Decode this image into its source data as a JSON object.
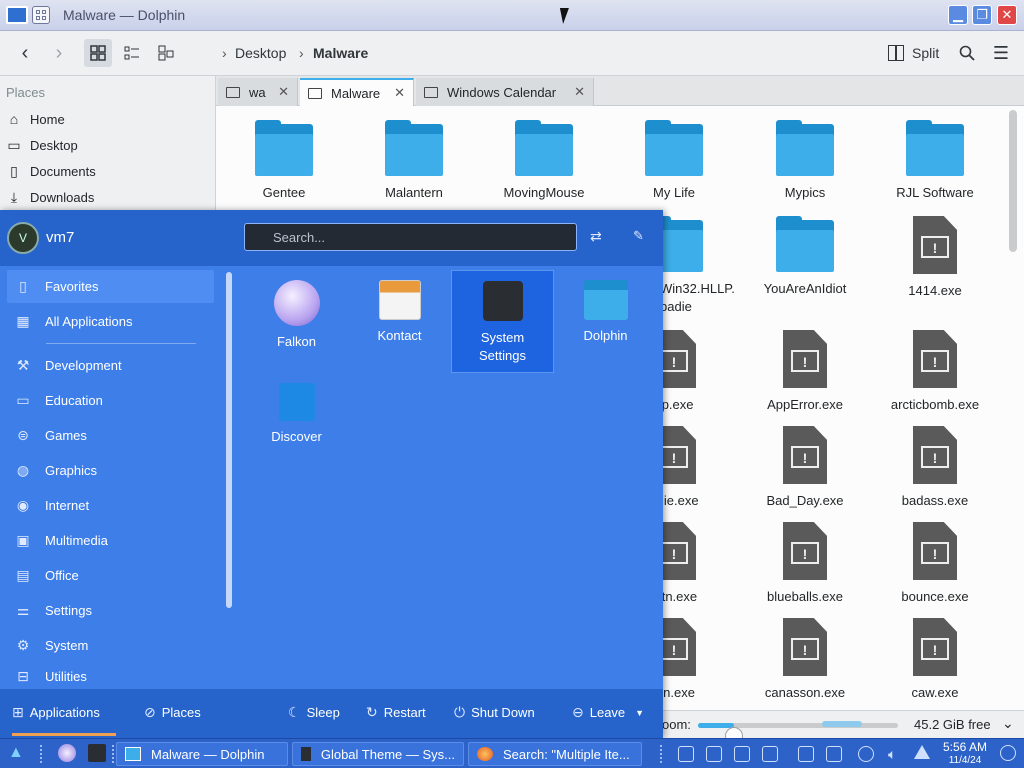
{
  "window": {
    "title": "Malware — Dolphin"
  },
  "toolbar": {
    "breadcrumbs": [
      "Desktop",
      "Malware"
    ],
    "split_label": "Split"
  },
  "places": {
    "header": "Places",
    "items": [
      {
        "label": "Home",
        "icon": "home-icon"
      },
      {
        "label": "Desktop",
        "icon": "desktop-icon"
      },
      {
        "label": "Documents",
        "icon": "documents-icon"
      },
      {
        "label": "Downloads",
        "icon": "downloads-icon"
      }
    ]
  },
  "tabs": [
    {
      "label": "wa",
      "active": false
    },
    {
      "label": "Malware",
      "active": true
    },
    {
      "label": "Windows Calendar",
      "active": false
    }
  ],
  "files": {
    "row1": [
      "Gentee",
      "Malantern",
      "MovingMouse",
      "My Life",
      "Mypics",
      "RJL Software"
    ],
    "row2": [
      "Win32.HLLP.\nbadie",
      "YouAreAnIdiot",
      "1414.exe"
    ],
    "row3": [
      "ap.exe",
      "AppError.exe",
      "arcticbomb.exe"
    ],
    "row4": [
      "ralie.exe",
      "Bad_Day.exe",
      "badass.exe"
    ],
    "row5": [
      "tbtn.exe",
      "blueballs.exe",
      "bounce.exe"
    ],
    "row6": [
      "jun.exe",
      "canasson.exe",
      "caw.exe"
    ]
  },
  "statusbar": {
    "zoom_label": "oom:",
    "free_space": "45.2 GiB free",
    "zoom_fraction": 0.18
  },
  "launcher": {
    "avatar_initial": "V",
    "username": "vm7",
    "search_placeholder": "Search...",
    "categories": [
      {
        "label": "Favorites",
        "icon": "bookmark-icon",
        "active": true
      },
      {
        "label": "All Applications",
        "icon": "grid-icon"
      },
      {
        "label": "Development",
        "icon": "hammer-icon"
      },
      {
        "label": "Education",
        "icon": "monitor-icon"
      },
      {
        "label": "Games",
        "icon": "gamepad-icon"
      },
      {
        "label": "Graphics",
        "icon": "palette-icon"
      },
      {
        "label": "Internet",
        "icon": "globe-icon"
      },
      {
        "label": "Multimedia",
        "icon": "media-icon"
      },
      {
        "label": "Office",
        "icon": "document-icon"
      },
      {
        "label": "Settings",
        "icon": "sliders-icon"
      },
      {
        "label": "System",
        "icon": "gear-icon"
      },
      {
        "label": "Utilities",
        "icon": "toolbox-icon"
      }
    ],
    "favorites": [
      {
        "label": "Falkon",
        "icon": "falkon-icon"
      },
      {
        "label": "Kontact",
        "icon": "kontact-icon"
      },
      {
        "label": "System\nSettings",
        "icon": "system-settings-icon",
        "active": true
      },
      {
        "label": "Dolphin",
        "icon": "dolphin-icon"
      },
      {
        "label": "Discover",
        "icon": "discover-icon"
      }
    ],
    "bottom": {
      "applications": "Applications",
      "places": "Places",
      "sleep": "Sleep",
      "restart": "Restart",
      "shutdown": "Shut Down",
      "leave": "Leave"
    }
  },
  "taskbar": {
    "tasks": [
      {
        "label": "Malware — Dolphin"
      },
      {
        "label": "Global Theme — Sys..."
      },
      {
        "label": "Search: \"Multiple Ite..."
      }
    ],
    "time": "5:56 AM",
    "date": "11/4/24"
  },
  "colors": {
    "accent": "#3daee9",
    "launcher_bg": "#3d7ee8",
    "taskbar_bg": "#2d62c8"
  }
}
